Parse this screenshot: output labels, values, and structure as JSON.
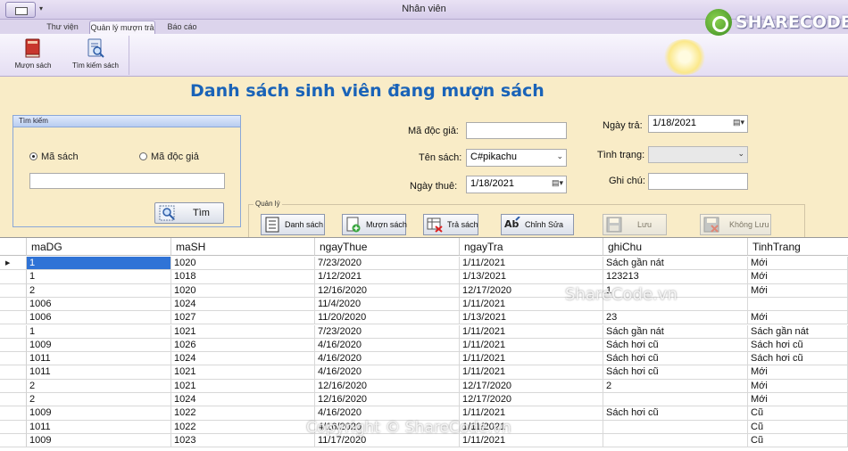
{
  "window": {
    "title": "Nhân viên"
  },
  "tabs": [
    {
      "label": "Thư viện"
    },
    {
      "label": "Quản lý mượn trả"
    },
    {
      "label": "Báo cáo"
    }
  ],
  "ribbon": {
    "buttons": [
      {
        "label": "Mượn sách",
        "icon": "book-icon"
      },
      {
        "label": "Tìm kiếm sách",
        "icon": "search-book-icon"
      }
    ]
  },
  "logo": {
    "text": "SHARECODE.vn"
  },
  "page": {
    "title": "Danh sách sinh viên đang mượn sách"
  },
  "search": {
    "group_title": "Tìm kiếm",
    "radio_ma_sach": "Mã sách",
    "radio_ma_doc_gia": "Mã độc giả",
    "selected": "Mã sách",
    "input_value": "",
    "button_label": "Tìm"
  },
  "form": {
    "ma_doc_gia_label": "Mã độc giả:",
    "ma_doc_gia_value": "",
    "ten_sach_label": "Tên sách:",
    "ten_sach_value": "C#pikachu",
    "ngay_thue_label": "Ngày thuê:",
    "ngay_thue_value": "1/18/2021",
    "ngay_tra_label": "Ngày trả:",
    "ngay_tra_value": "1/18/2021",
    "tinh_trang_label": "Tình trạng:",
    "tinh_trang_value": "",
    "ghi_chu_label": "Ghi chú:",
    "ghi_chu_value": ""
  },
  "quanly": {
    "legend": "Quản lý",
    "buttons": [
      {
        "label": "Danh sách",
        "enabled": true
      },
      {
        "label": "Mượn sách",
        "enabled": true
      },
      {
        "label": "Trả sách",
        "enabled": true
      },
      {
        "label": "Chỉnh Sửa",
        "enabled": true
      },
      {
        "label": "Lưu",
        "enabled": false
      },
      {
        "label": "Không Lưu",
        "enabled": false
      }
    ]
  },
  "grid": {
    "columns": [
      "maDG",
      "maSH",
      "ngayThue",
      "ngayTra",
      "ghiChu",
      "TinhTrang"
    ],
    "rows": [
      [
        "1",
        "1020",
        "7/23/2020",
        "1/11/2021",
        "Sách gần nát",
        "Mới"
      ],
      [
        "1",
        "1018",
        "1/12/2021",
        "1/13/2021",
        "123213",
        "Mới"
      ],
      [
        "2",
        "1020",
        "12/16/2020",
        "12/17/2020",
        "1",
        "Mới"
      ],
      [
        "1006",
        "1024",
        "11/4/2020",
        "1/11/2021",
        "",
        ""
      ],
      [
        "1006",
        "1027",
        "11/20/2020",
        "1/13/2021",
        "23",
        "Mới"
      ],
      [
        "1",
        "1021",
        "7/23/2020",
        "1/11/2021",
        "Sách gần nát",
        "Sách gần nát"
      ],
      [
        "1009",
        "1026",
        "4/16/2020",
        "1/11/2021",
        "Sách hơi cũ",
        "Sách hơi cũ"
      ],
      [
        "1011",
        "1024",
        "4/16/2020",
        "1/11/2021",
        "Sách hơi cũ",
        "Sách hơi cũ"
      ],
      [
        "1011",
        "1021",
        "4/16/2020",
        "1/11/2021",
        "Sách hơi cũ",
        "Mới"
      ],
      [
        "2",
        "1021",
        "12/16/2020",
        "12/17/2020",
        "2",
        "Mới"
      ],
      [
        "2",
        "1024",
        "12/16/2020",
        "12/17/2020",
        "",
        "Mới"
      ],
      [
        "1009",
        "1022",
        "4/16/2020",
        "1/11/2021",
        "Sách hơi cũ",
        "Cũ"
      ],
      [
        "1011",
        "1022",
        "4/16/2020",
        "1/11/2021",
        "",
        "Cũ"
      ],
      [
        "1009",
        "1023",
        "11/17/2020",
        "1/11/2021",
        "",
        "Cũ"
      ]
    ],
    "selected_row": 0
  },
  "watermarks": {
    "middle": "ShareCode.vn",
    "bottom": "Copyright © ShareCode.vn"
  }
}
